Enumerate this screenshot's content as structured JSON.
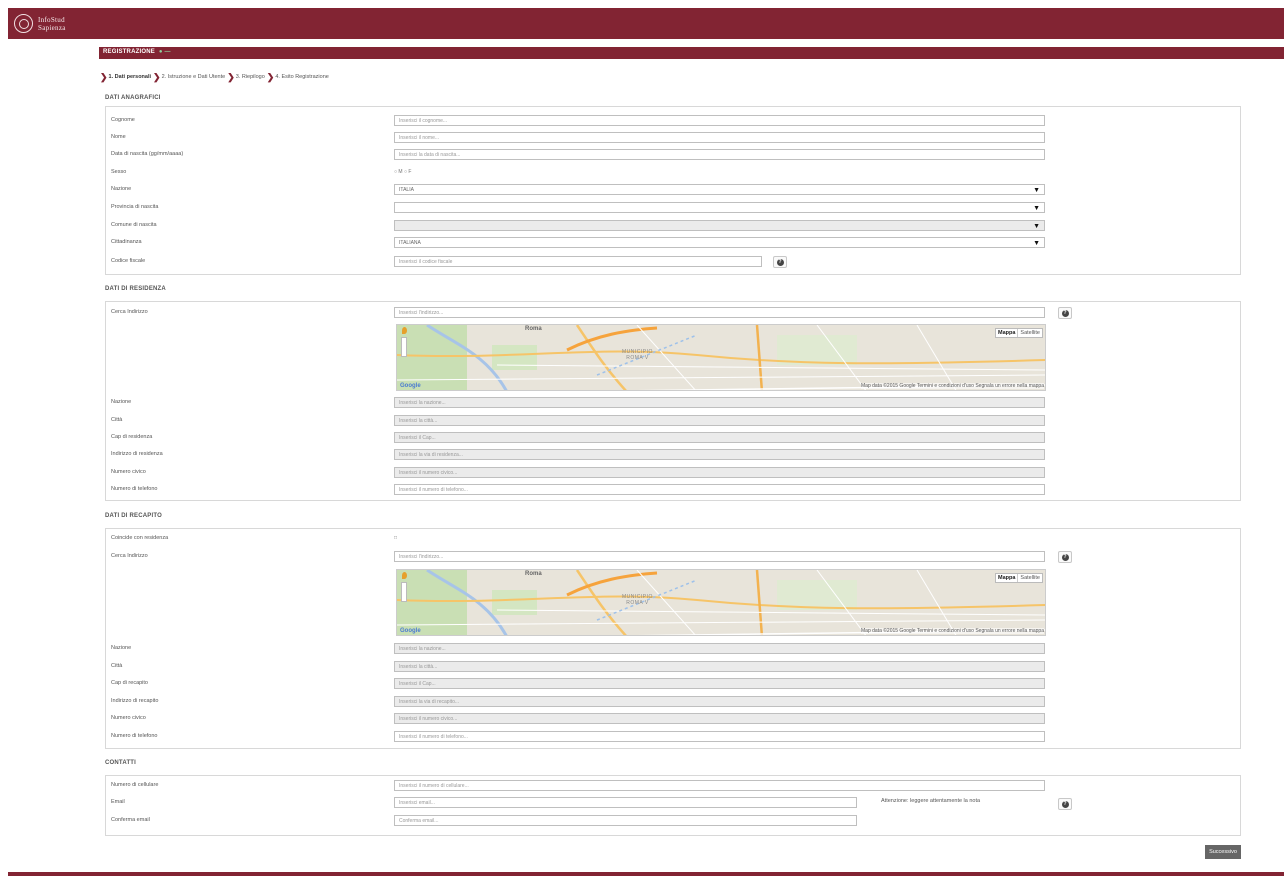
{
  "header": {
    "logo_line1": "InfoStud",
    "logo_line2": "Sapienza",
    "section_title": "REGISTRAZIONE",
    "section_marker": "● —"
  },
  "steps": [
    {
      "label": "1. Dati personali",
      "active": true
    },
    {
      "label": "2. Istruzione e Dati Utente",
      "active": false
    },
    {
      "label": "3. Riepilogo",
      "active": false
    },
    {
      "label": "4. Esito Registrazione",
      "active": false
    }
  ],
  "anagrafici": {
    "title": "DATI ANAGRAFICI",
    "cognome": {
      "label": "Cognome",
      "placeholder": "Inserisci il cognome..."
    },
    "nome": {
      "label": "Nome",
      "placeholder": "Inserisci il nome..."
    },
    "data_nascita": {
      "label": "Data di nascita (gg/mm/aaaa)",
      "placeholder": "Inserisci la data di nascita..."
    },
    "sesso": {
      "label": "Sesso",
      "options": "○ M ○ F"
    },
    "nazione": {
      "label": "Nazione",
      "value": "ITALIA"
    },
    "provincia": {
      "label": "Provincia di nascita",
      "value": ""
    },
    "comune": {
      "label": "Comune di nascita",
      "value": ""
    },
    "cittadinanza": {
      "label": "Cittadinanza",
      "value": "ITALIANA"
    },
    "codice_fiscale": {
      "label": "Codice fiscale",
      "placeholder": "Inserisci il codice fiscale"
    }
  },
  "residenza": {
    "title": "DATI DI RESIDENZA",
    "cerca": {
      "label": "Cerca Indirizzo",
      "placeholder": "Inserisci l'indirizzo..."
    },
    "nazione": {
      "label": "Nazione",
      "placeholder": "Inserisci la nazione..."
    },
    "citta": {
      "label": "Città",
      "placeholder": "Inserisci la città..."
    },
    "cap": {
      "label": "Cap di residenza",
      "placeholder": "Inserisci il Cap..."
    },
    "indirizzo": {
      "label": "Indirizzo di residenza",
      "placeholder": "Inserisci la via di residenza..."
    },
    "civico": {
      "label": "Numero civico",
      "placeholder": "Inserisci il numero civico..."
    },
    "telefono": {
      "label": "Numero di telefono",
      "placeholder": "Inserisci il numero di telefono..."
    }
  },
  "recapito": {
    "title": "DATI DI RECAPITO",
    "coincide": {
      "label": "Coincide con residenza",
      "option": "□"
    },
    "cerca": {
      "label": "Cerca Indirizzo",
      "placeholder": "Inserisci l'indirizzo..."
    },
    "nazione": {
      "label": "Nazione",
      "placeholder": "Inserisci la nazione..."
    },
    "citta": {
      "label": "Città",
      "placeholder": "Inserisci la città..."
    },
    "cap": {
      "label": "Cap di recapito",
      "placeholder": "Inserisci il Cap..."
    },
    "indirizzo": {
      "label": "Indirizzo di recapito",
      "placeholder": "Inserisci la via di recapito..."
    },
    "civico": {
      "label": "Numero civico",
      "placeholder": "Inserisci il numero civico..."
    },
    "telefono": {
      "label": "Numero di telefono",
      "placeholder": "Inserisci il numero di telefono..."
    }
  },
  "map": {
    "mappa": "Mappa",
    "satellite": "Satellite",
    "google": "Google",
    "credit": "Map data ©2015 Google   Termini e condizioni d'uso   Segnala un errore nella mappa",
    "city": "Roma",
    "area": "MUNICIPIO\nROMA V"
  },
  "contatti": {
    "title": "CONTATTI",
    "cellulare": {
      "label": "Numero di cellulare",
      "placeholder": "Inserisci il numero di cellulare..."
    },
    "email": {
      "label": "Email",
      "placeholder": "Inserisci email..."
    },
    "note": "Attenzione: leggere attentamente la nota",
    "conferma": {
      "label": "Conferma email",
      "placeholder": "Conferma email..."
    }
  },
  "buttons": {
    "next": "Successivo",
    "help": "?"
  },
  "colors": {
    "brand": "#822433"
  }
}
